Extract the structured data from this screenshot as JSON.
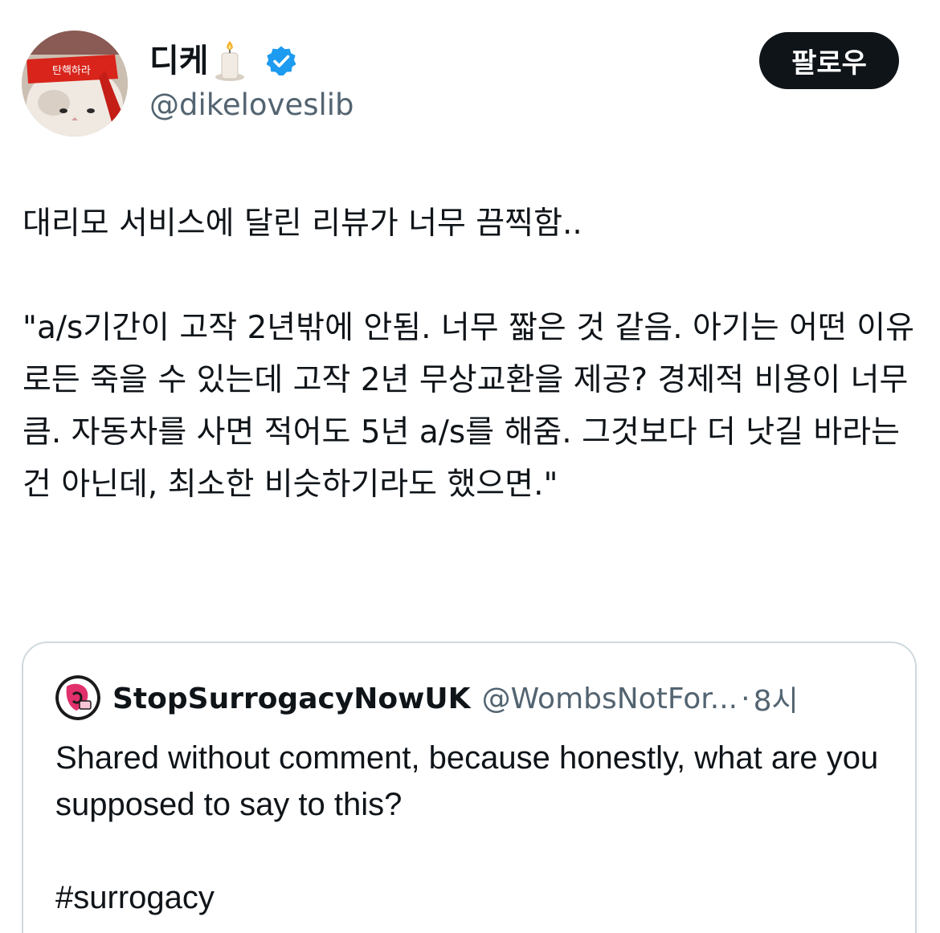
{
  "author": {
    "display_name": "디케",
    "emoji_icon": "candle-icon",
    "verified_icon": "verified-badge-icon",
    "handle": "@dikeloveslib",
    "avatar_headband_text": "탄핵하라",
    "avatar_icon": "cat-with-red-headband"
  },
  "follow_button": {
    "label": "팔로우",
    "bg_color": "#0f1419"
  },
  "tweet": {
    "text": "대리모 서비스에 달린 리뷰가 너무 끔찍함..\n\n\"a/s기간이 고작 2년밖에 안됨. 너무 짧은 것 같음. 아기는 어떤 이유로든 죽을 수 있는데 고작 2년 무상교환을 제공? 경제적 비용이 너무 큼. 자동차를 사면 적어도 5년 a/s를 해줌. 그것보다 더 낫길 바라는 건 아닌데, 최소한 비슷하기라도 했으면.\""
  },
  "quoted_tweet": {
    "display_name": "StopSurrogacyNowUK",
    "handle": "@WombsNotFor...",
    "separator": "·",
    "time": "8시",
    "avatar_icon": "stop-surrogacy-logo",
    "text": "Shared without comment, because honestly, what are you supposed to say to this?\n\n#surrogacy"
  },
  "colors": {
    "text": "#0f1419",
    "secondary": "#536471",
    "verified": "#1d9bf0",
    "border": "#cfd9de"
  }
}
